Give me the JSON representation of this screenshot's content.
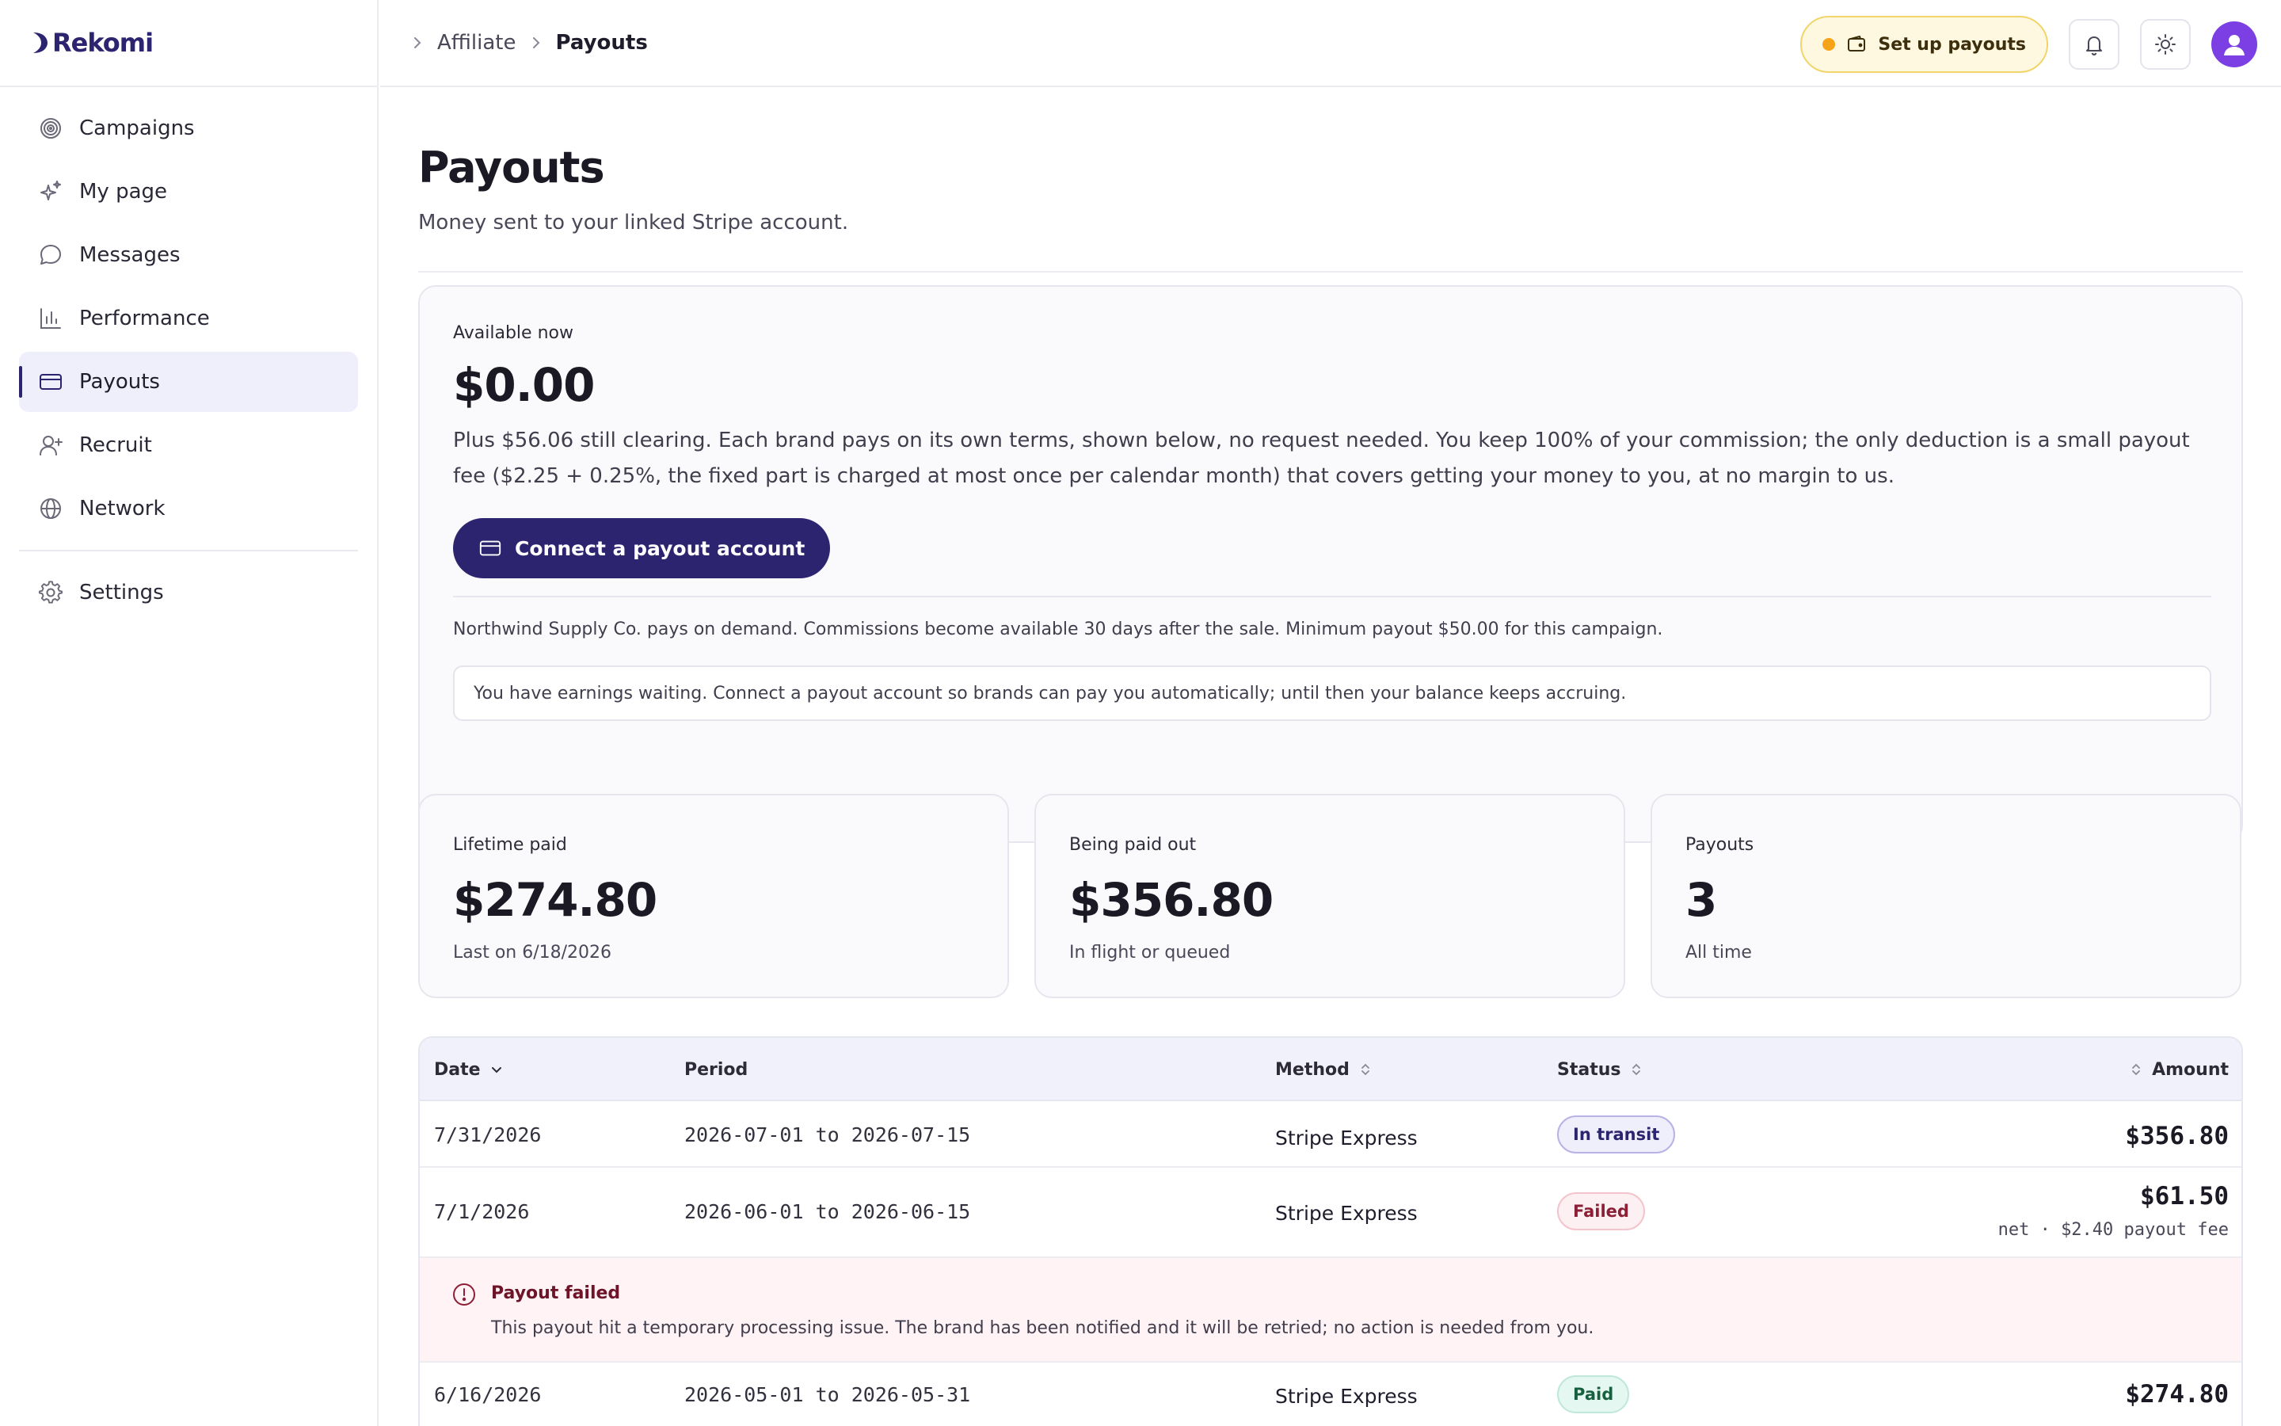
{
  "brand": {
    "name": "Rekomi"
  },
  "sidebar": {
    "items": [
      {
        "label": "Campaigns",
        "icon": "target-icon"
      },
      {
        "label": "My page",
        "icon": "sparkles-icon"
      },
      {
        "label": "Messages",
        "icon": "chat-bubble-icon"
      },
      {
        "label": "Performance",
        "icon": "bar-chart-icon"
      },
      {
        "label": "Payouts",
        "icon": "credit-card-icon",
        "active": true
      },
      {
        "label": "Recruit",
        "icon": "user-plus-icon"
      },
      {
        "label": "Network",
        "icon": "globe-icon"
      }
    ],
    "settings": {
      "label": "Settings",
      "icon": "gear-icon"
    }
  },
  "topbar": {
    "breadcrumbs": [
      "Affiliate",
      "Payouts"
    ],
    "setup_label": "Set up payouts",
    "icons": [
      "bell-icon",
      "sun-icon",
      "user-avatar-icon"
    ]
  },
  "page": {
    "title": "Payouts",
    "subtitle": "Money sent to your linked Stripe account."
  },
  "balance": {
    "label": "Available now",
    "amount": "$0.00",
    "description": "Plus $56.06 still clearing. Each brand pays on its own terms, shown below, no request needed. You keep 100% of your commission; the only deduction is a small payout fee ($2.25 + 0.25%, the fixed part is charged at most once per calendar month) that covers getting your money to you, at no margin to us.",
    "connect_label": "Connect a payout account",
    "terms": "Northwind Supply Co. pays on demand. Commissions become available 30 days after the sale. Minimum payout $50.00 for this campaign.",
    "notice": "You have earnings waiting. Connect a payout account so brands can pay you automatically; until then your balance keeps accruing."
  },
  "stats": [
    {
      "label": "Lifetime paid",
      "value": "$274.80",
      "sub": "Last on 6/18/2026"
    },
    {
      "label": "Being paid out",
      "value": "$356.80",
      "sub": "In flight or queued"
    },
    {
      "label": "Payouts",
      "value": "3",
      "sub": "All time"
    }
  ],
  "table": {
    "columns": {
      "date": "Date",
      "period": "Period",
      "method": "Method",
      "status": "Status",
      "amount": "Amount"
    },
    "rows": [
      {
        "date": "7/31/2026",
        "period": "2026-07-01 to 2026-07-15",
        "method": "Stripe Express",
        "status": "In transit",
        "amount": "$356.80",
        "note": ""
      },
      {
        "date": "7/1/2026",
        "period": "2026-06-01 to 2026-06-15",
        "method": "Stripe Express",
        "status": "Failed",
        "amount": "$61.50",
        "note": "net · $2.40 payout fee"
      },
      {
        "date": "6/16/2026",
        "period": "2026-05-01 to 2026-05-31",
        "method": "Stripe Express",
        "status": "Paid",
        "amount": "$274.80",
        "note": ""
      }
    ],
    "failure": {
      "title": "Payout failed",
      "text": "This payout hit a temporary processing issue. The brand has been notified and it will be retried; no action is needed from you."
    }
  },
  "colors": {
    "brand": "#2d2470",
    "active_nav_bg": "#efeefb",
    "warning_dot": "#f4a416",
    "failed": "#8c1f35",
    "paid": "#16603f"
  }
}
